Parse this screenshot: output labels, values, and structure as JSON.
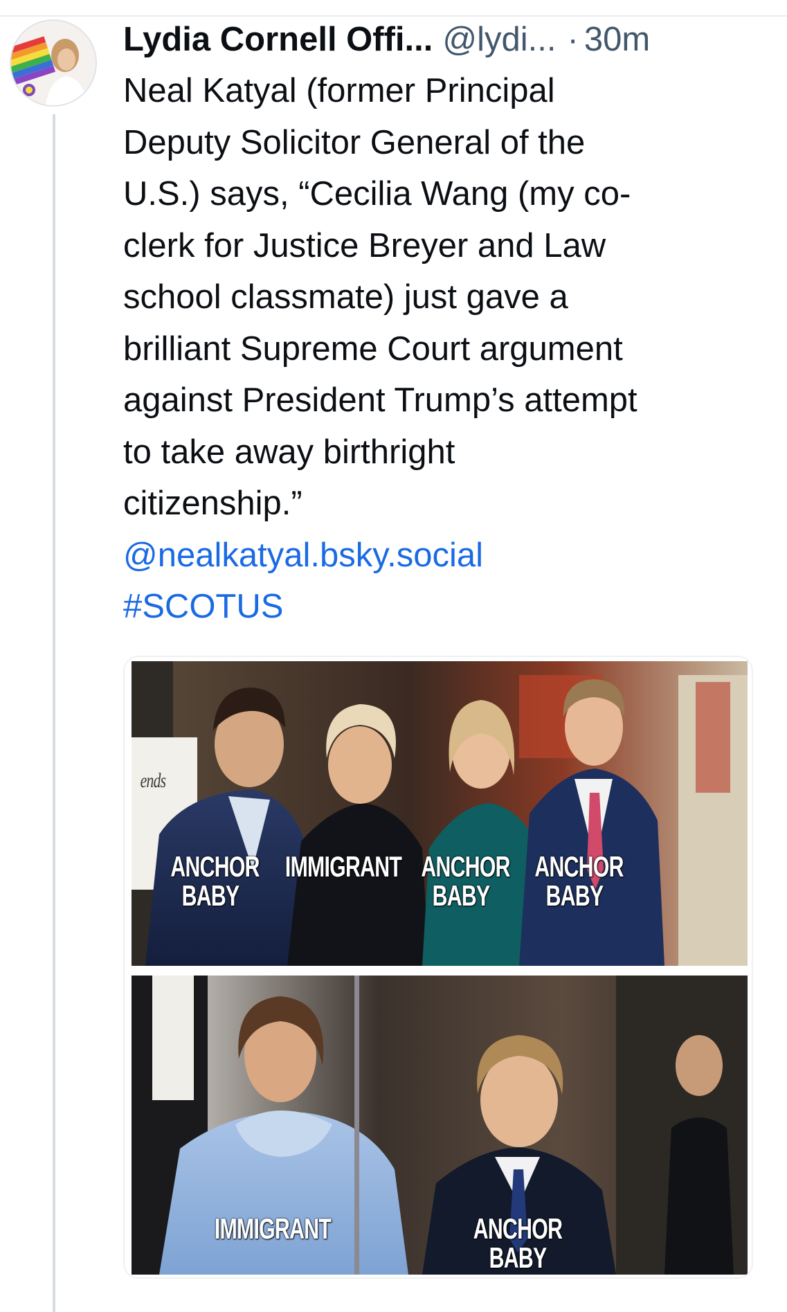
{
  "post": {
    "author_name": "Lydia Cornell Offi...",
    "author_handle": "@lydi...",
    "separator": "·",
    "timestamp": "30m",
    "text": "Neal Katyal (former Principal\nDeputy Solicitor General of the\nU.S.) says, “Cecilia Wang (my co-\nclerk for Justice Breyer and Law\nschool classmate) just gave a\nbrilliant Supreme Court argument\nagainst President Trump’s attempt\nto take away birthright\ncitizenship.”",
    "mention": "@nealkatyal.bsky.social",
    "hashtag": "#SCOTUS"
  },
  "image": {
    "top_panel": {
      "sign_text": "ends",
      "captions": [
        "ANCHOR\nBABY",
        "IMMIGRANT",
        "ANCHOR\nBABY",
        "ANCHOR\nBABY"
      ]
    },
    "bottom_panel": {
      "captions": [
        "IMMIGRANT",
        "ANCHOR BABY"
      ]
    }
  },
  "colors": {
    "link": "#1a6ae4",
    "meta": "#42576c",
    "thread_line": "#d6dbe0"
  }
}
